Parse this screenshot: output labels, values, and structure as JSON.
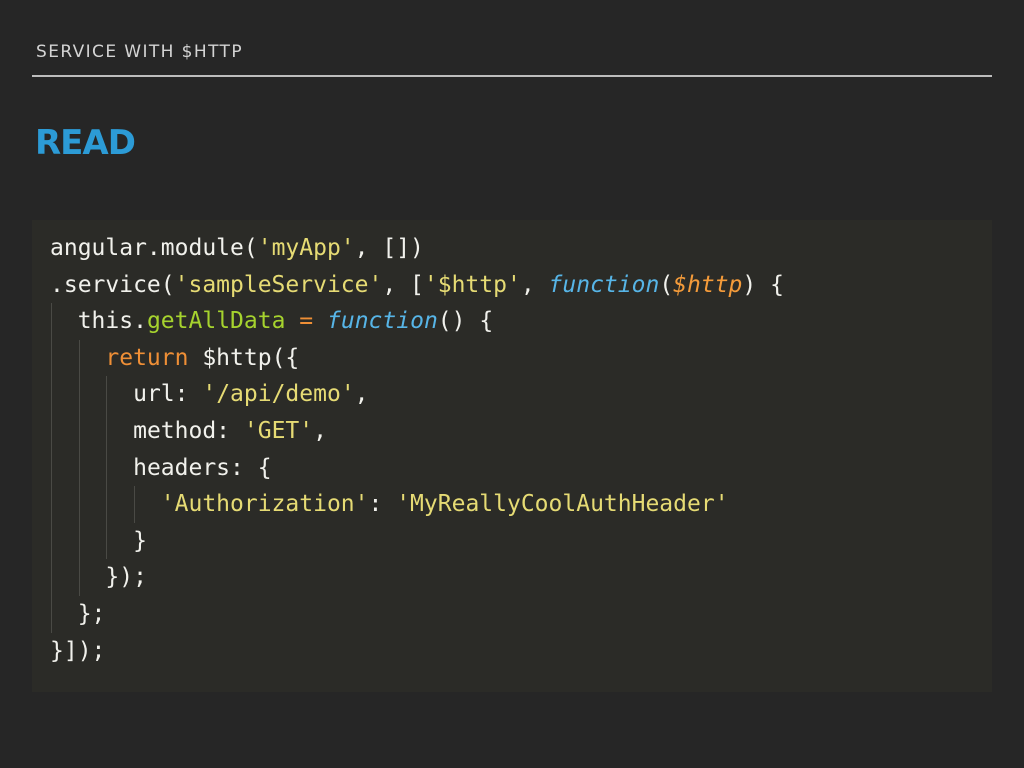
{
  "header": {
    "section": "SERVICE WITH $HTTP"
  },
  "title": "READ",
  "code": {
    "language": "javascript",
    "lines": [
      {
        "indent": 0,
        "tokens": [
          {
            "t": "angular.module(",
            "c": "plain"
          },
          {
            "t": "'myApp'",
            "c": "str"
          },
          {
            "t": ", [])",
            "c": "plain"
          }
        ]
      },
      {
        "indent": 0,
        "tokens": [
          {
            "t": ".service(",
            "c": "plain"
          },
          {
            "t": "'sampleService'",
            "c": "str"
          },
          {
            "t": ", [",
            "c": "plain"
          },
          {
            "t": "'$http'",
            "c": "str"
          },
          {
            "t": ", ",
            "c": "plain"
          },
          {
            "t": "function",
            "c": "stor"
          },
          {
            "t": "(",
            "c": "plain"
          },
          {
            "t": "$http",
            "c": "par"
          },
          {
            "t": ") {",
            "c": "plain"
          }
        ]
      },
      {
        "indent": 1,
        "tokens": [
          {
            "t": "this.",
            "c": "plain"
          },
          {
            "t": "getAllData",
            "c": "fn"
          },
          {
            "t": " ",
            "c": "plain"
          },
          {
            "t": "=",
            "c": "kw"
          },
          {
            "t": " ",
            "c": "plain"
          },
          {
            "t": "function",
            "c": "stor"
          },
          {
            "t": "() {",
            "c": "plain"
          }
        ]
      },
      {
        "indent": 2,
        "tokens": [
          {
            "t": "return",
            "c": "kw"
          },
          {
            "t": " $http({",
            "c": "plain"
          }
        ]
      },
      {
        "indent": 3,
        "tokens": [
          {
            "t": "url: ",
            "c": "plain"
          },
          {
            "t": "'/api/demo'",
            "c": "str"
          },
          {
            "t": ",",
            "c": "plain"
          }
        ]
      },
      {
        "indent": 3,
        "tokens": [
          {
            "t": "method: ",
            "c": "plain"
          },
          {
            "t": "'GET'",
            "c": "str"
          },
          {
            "t": ",",
            "c": "plain"
          }
        ]
      },
      {
        "indent": 3,
        "tokens": [
          {
            "t": "headers: {",
            "c": "plain"
          }
        ]
      },
      {
        "indent": 4,
        "tokens": [
          {
            "t": "'Authorization'",
            "c": "str"
          },
          {
            "t": ": ",
            "c": "plain"
          },
          {
            "t": "'MyReallyCoolAuthHeader'",
            "c": "str"
          }
        ]
      },
      {
        "indent": 3,
        "tokens": [
          {
            "t": "}",
            "c": "plain"
          }
        ]
      },
      {
        "indent": 2,
        "tokens": [
          {
            "t": "});",
            "c": "plain"
          }
        ]
      },
      {
        "indent": 1,
        "tokens": [
          {
            "t": "};",
            "c": "plain"
          }
        ]
      },
      {
        "indent": 0,
        "tokens": [
          {
            "t": "}]);",
            "c": "plain"
          }
        ]
      }
    ]
  },
  "colors": {
    "background": "#262626",
    "code_background": "#2b2b27",
    "title": "#2c9bd6",
    "string": "#e6db74",
    "keyword": "#ef8f36",
    "function_name": "#a6d32e",
    "storage": "#57b5e7",
    "parameter": "#f49b3a"
  }
}
